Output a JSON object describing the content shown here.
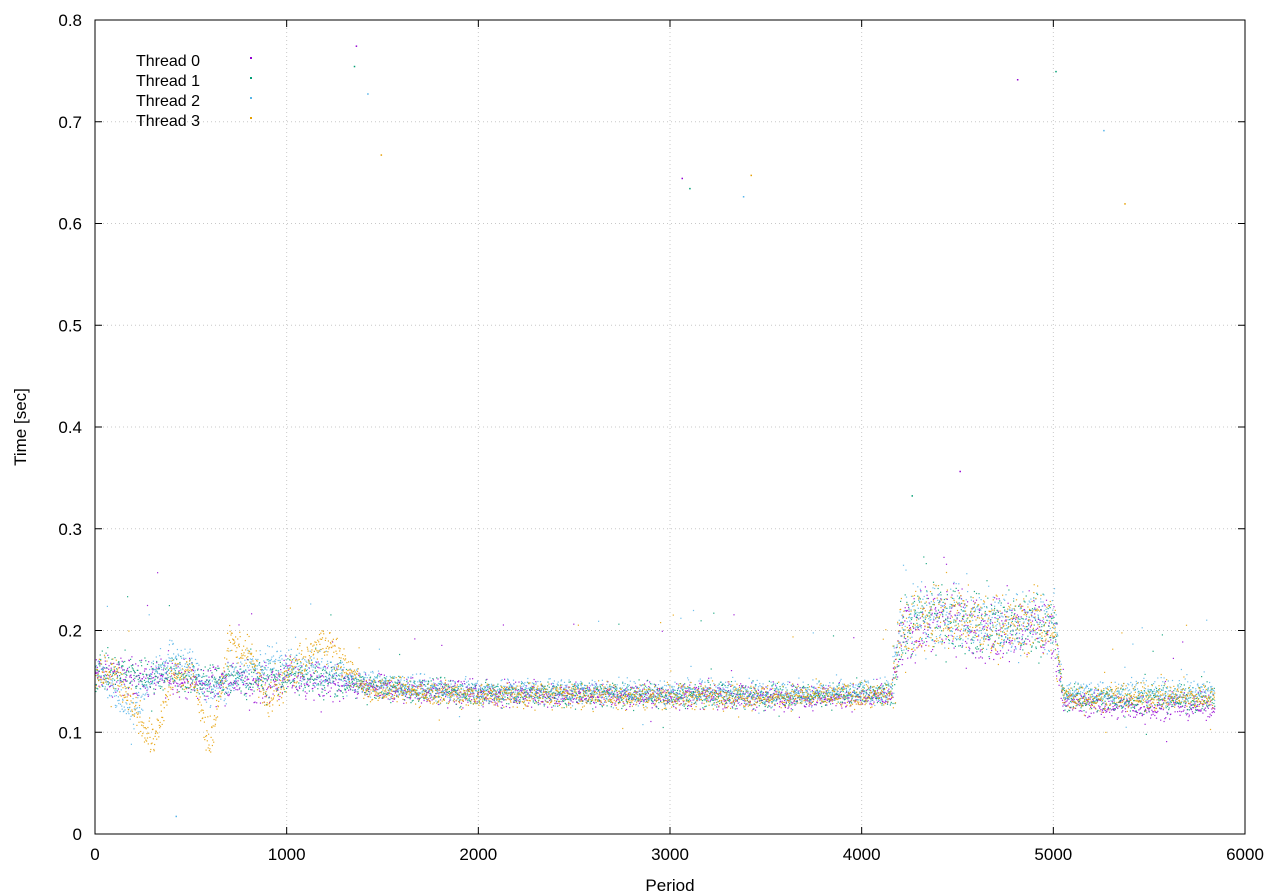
{
  "chart_data": {
    "type": "scatter",
    "title": "",
    "xlabel": "Period",
    "ylabel": "Time [sec]",
    "xlim": [
      0,
      6000
    ],
    "ylim": [
      0,
      0.8
    ],
    "xticks": [
      0,
      1000,
      2000,
      3000,
      4000,
      5000,
      6000
    ],
    "yticks": [
      0,
      0.1,
      0.2,
      0.3,
      0.4,
      0.5,
      0.6,
      0.7,
      0.8
    ],
    "xtick_labels": [
      "0",
      "1000",
      "2000",
      "3000",
      "4000",
      "5000",
      "6000"
    ],
    "ytick_labels": [
      "0",
      "0.1",
      "0.2",
      "0.3",
      "0.4",
      "0.5",
      "0.6",
      "0.7",
      "0.8"
    ],
    "grid": true,
    "legend_position": "top-left",
    "series": [
      {
        "name": "Thread 0",
        "color": "#9400d3",
        "x": [
          0,
          100,
          200,
          300,
          400,
          500,
          600,
          700,
          800,
          900,
          1000,
          1200,
          1400,
          1600,
          1800,
          2000,
          2200,
          2400,
          2600,
          2800,
          3000,
          3200,
          3400,
          3600,
          3800,
          4000,
          4150,
          4200,
          4300,
          4400,
          4500,
          4600,
          4700,
          4800,
          4900,
          5000,
          5050,
          5200,
          5400,
          5600,
          5800
        ],
        "y": [
          0.158,
          0.155,
          0.156,
          0.152,
          0.158,
          0.15,
          0.148,
          0.152,
          0.15,
          0.148,
          0.155,
          0.15,
          0.145,
          0.142,
          0.14,
          0.138,
          0.138,
          0.137,
          0.137,
          0.137,
          0.136,
          0.137,
          0.136,
          0.136,
          0.136,
          0.135,
          0.136,
          0.19,
          0.205,
          0.21,
          0.21,
          0.2,
          0.2,
          0.2,
          0.205,
          0.2,
          0.13,
          0.128,
          0.126,
          0.126,
          0.126
        ]
      },
      {
        "name": "Thread 1",
        "color": "#009e73",
        "x": [
          0,
          100,
          200,
          300,
          400,
          500,
          600,
          700,
          800,
          900,
          1000,
          1200,
          1400,
          1600,
          1800,
          2000,
          2200,
          2400,
          2600,
          2800,
          3000,
          3200,
          3400,
          3600,
          3800,
          4000,
          4150,
          4200,
          4300,
          4400,
          4500,
          4600,
          4700,
          4800,
          4900,
          5000,
          5050,
          5200,
          5400,
          5600,
          5800
        ],
        "y": [
          0.16,
          0.158,
          0.158,
          0.155,
          0.16,
          0.153,
          0.15,
          0.155,
          0.152,
          0.152,
          0.157,
          0.152,
          0.146,
          0.143,
          0.141,
          0.139,
          0.139,
          0.138,
          0.138,
          0.138,
          0.137,
          0.138,
          0.137,
          0.137,
          0.137,
          0.137,
          0.137,
          0.195,
          0.21,
          0.212,
          0.212,
          0.205,
          0.205,
          0.204,
          0.208,
          0.205,
          0.134,
          0.134,
          0.133,
          0.133,
          0.133
        ]
      },
      {
        "name": "Thread 2",
        "color": "#56b4e9",
        "x": [
          0,
          100,
          200,
          300,
          400,
          500,
          600,
          700,
          800,
          900,
          1000,
          1200,
          1400,
          1600,
          1800,
          2000,
          2200,
          2400,
          2600,
          2800,
          3000,
          3200,
          3400,
          3600,
          3800,
          4000,
          4150,
          4200,
          4300,
          4400,
          4500,
          4600,
          4700,
          4800,
          4900,
          5000,
          5050,
          5200,
          5400,
          5600,
          5800
        ],
        "y": [
          0.162,
          0.14,
          0.12,
          0.158,
          0.175,
          0.165,
          0.14,
          0.15,
          0.162,
          0.17,
          0.165,
          0.16,
          0.15,
          0.146,
          0.143,
          0.142,
          0.142,
          0.141,
          0.141,
          0.14,
          0.14,
          0.141,
          0.14,
          0.14,
          0.14,
          0.14,
          0.14,
          0.2,
          0.215,
          0.215,
          0.215,
          0.208,
          0.208,
          0.207,
          0.212,
          0.21,
          0.14,
          0.14,
          0.14,
          0.14,
          0.14
        ]
      },
      {
        "name": "Thread 3",
        "color": "#e69f00",
        "x": [
          0,
          100,
          200,
          300,
          400,
          500,
          600,
          700,
          800,
          900,
          1000,
          1200,
          1400,
          1600,
          1800,
          2000,
          2200,
          2400,
          2600,
          2800,
          3000,
          3200,
          3400,
          3600,
          3800,
          4000,
          4150,
          4200,
          4300,
          4400,
          4500,
          4600,
          4700,
          4800,
          4900,
          5000,
          5050,
          5200,
          5400,
          5600,
          5800
        ],
        "y": [
          0.158,
          0.16,
          0.125,
          0.09,
          0.155,
          0.16,
          0.085,
          0.19,
          0.18,
          0.128,
          0.155,
          0.19,
          0.144,
          0.141,
          0.139,
          0.137,
          0.137,
          0.137,
          0.137,
          0.136,
          0.136,
          0.137,
          0.136,
          0.136,
          0.136,
          0.136,
          0.136,
          0.198,
          0.212,
          0.213,
          0.213,
          0.206,
          0.206,
          0.205,
          0.21,
          0.206,
          0.135,
          0.135,
          0.135,
          0.135,
          0.135
        ]
      }
    ],
    "outliers": [
      {
        "x": 1360,
        "y": 0.775
      },
      {
        "x": 1350,
        "y": 0.755
      },
      {
        "x": 1420,
        "y": 0.728
      },
      {
        "x": 1490,
        "y": 0.668
      },
      {
        "x": 3060,
        "y": 0.645
      },
      {
        "x": 3100,
        "y": 0.635
      },
      {
        "x": 3380,
        "y": 0.627
      },
      {
        "x": 3420,
        "y": 0.648
      },
      {
        "x": 4810,
        "y": 0.742
      },
      {
        "x": 5010,
        "y": 0.75
      },
      {
        "x": 5260,
        "y": 0.692
      },
      {
        "x": 5370,
        "y": 0.62
      },
      {
        "x": 4510,
        "y": 0.357
      },
      {
        "x": 4260,
        "y": 0.333
      },
      {
        "x": 420,
        "y": 0.018
      }
    ]
  }
}
